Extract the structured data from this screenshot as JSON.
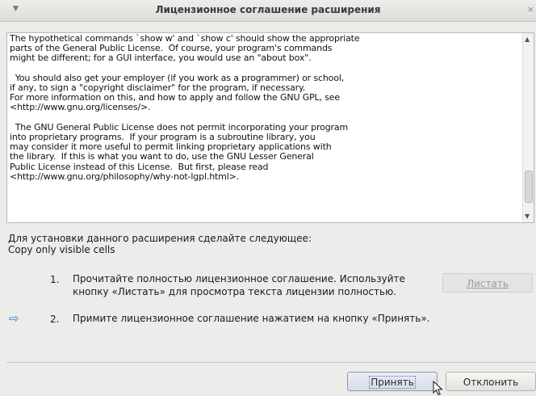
{
  "window": {
    "title": "Лицензионное соглашение расширения",
    "menu_glyph": "▼",
    "close_glyph": "×"
  },
  "license": {
    "text": "The hypothetical commands `show w' and `show c' should show the appropriate\nparts of the General Public License.  Of course, your program's commands\nmight be different; for a GUI interface, you would use an \"about box\".\n\n  You should also get your employer (if you work as a programmer) or school,\nif any, to sign a \"copyright disclaimer\" for the program, if necessary.\nFor more information on this, and how to apply and follow the GNU GPL, see\n<http://www.gnu.org/licenses/>.\n\n  The GNU General Public License does not permit incorporating your program\ninto proprietary programs.  If your program is a subroutine library, you\nmay consider it more useful to permit linking proprietary applications with\nthe library.  If this is what you want to do, use the GNU Lesser General\nPublic License instead of this License.  But first, please read\n<http://www.gnu.org/philosophy/why-not-lgpl.html>."
  },
  "scrollbar": {
    "up_glyph": "▲",
    "down_glyph": "▼",
    "position": 0.93
  },
  "instructions": {
    "heading": "Для установки данного расширения сделайте следующее:",
    "subheading": "Copy only visible cells",
    "steps": [
      {
        "number": "1.",
        "text": "Прочитайте полностью лицензионное соглашение. Используйте кнопку «Листать» для просмотра текста лицензии полностью."
      },
      {
        "number": "2.",
        "text": "Примите лицензионное соглашение нажатием на кнопку «Принять»."
      }
    ],
    "current_step_glyph": "⇨"
  },
  "buttons": {
    "scroll": "Листать",
    "accept": "Принять",
    "decline": "Отклонить"
  },
  "colors": {
    "accent": "#3b76c4",
    "background": "#ececea"
  }
}
